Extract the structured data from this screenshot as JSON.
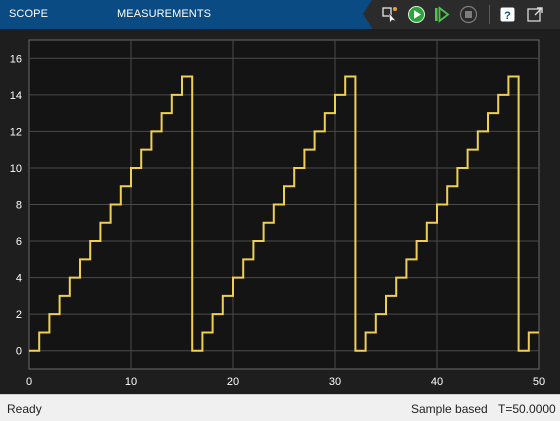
{
  "toolbar": {
    "tabs": [
      "SCOPE",
      "MEASUREMENTS"
    ],
    "icons": [
      "signal-highlight-icon",
      "run-icon",
      "step-forward-icon",
      "stop-icon",
      "help-icon",
      "undock-icon"
    ]
  },
  "colors": {
    "toolbar": "#0b4b84",
    "plot_background": "#141414",
    "grid": "#4a4a4a",
    "signal": "#f0d050",
    "axis_text": "#ffffff",
    "statusbar": "#f0f0f0"
  },
  "chart_data": {
    "type": "line",
    "step": true,
    "xlim": [
      0,
      50
    ],
    "ylim": [
      -1,
      17
    ],
    "xticks": [
      0,
      10,
      20,
      30,
      40,
      50
    ],
    "yticks": [
      0,
      2,
      4,
      6,
      8,
      10,
      12,
      14,
      16
    ],
    "grid": true,
    "series": [
      {
        "x": [
          0,
          1,
          2,
          3,
          4,
          5,
          6,
          7,
          8,
          9,
          10,
          11,
          12,
          13,
          14,
          15,
          16,
          17,
          18,
          19,
          20,
          21,
          22,
          23,
          24,
          25,
          26,
          27,
          28,
          29,
          30,
          31,
          32,
          33,
          34,
          35,
          36,
          37,
          38,
          39,
          40,
          41,
          42,
          43,
          44,
          45,
          46,
          47,
          48,
          49,
          50
        ],
        "y": [
          0,
          1,
          2,
          3,
          4,
          5,
          6,
          7,
          8,
          9,
          10,
          11,
          12,
          13,
          14,
          15,
          0,
          1,
          2,
          3,
          4,
          5,
          6,
          7,
          8,
          9,
          10,
          11,
          12,
          13,
          14,
          15,
          0,
          1,
          2,
          3,
          4,
          5,
          6,
          7,
          8,
          9,
          10,
          11,
          12,
          13,
          14,
          15,
          0,
          1,
          1
        ]
      }
    ]
  },
  "status": {
    "left": "Ready",
    "mode": "Sample based",
    "time": "T=50.0000"
  }
}
